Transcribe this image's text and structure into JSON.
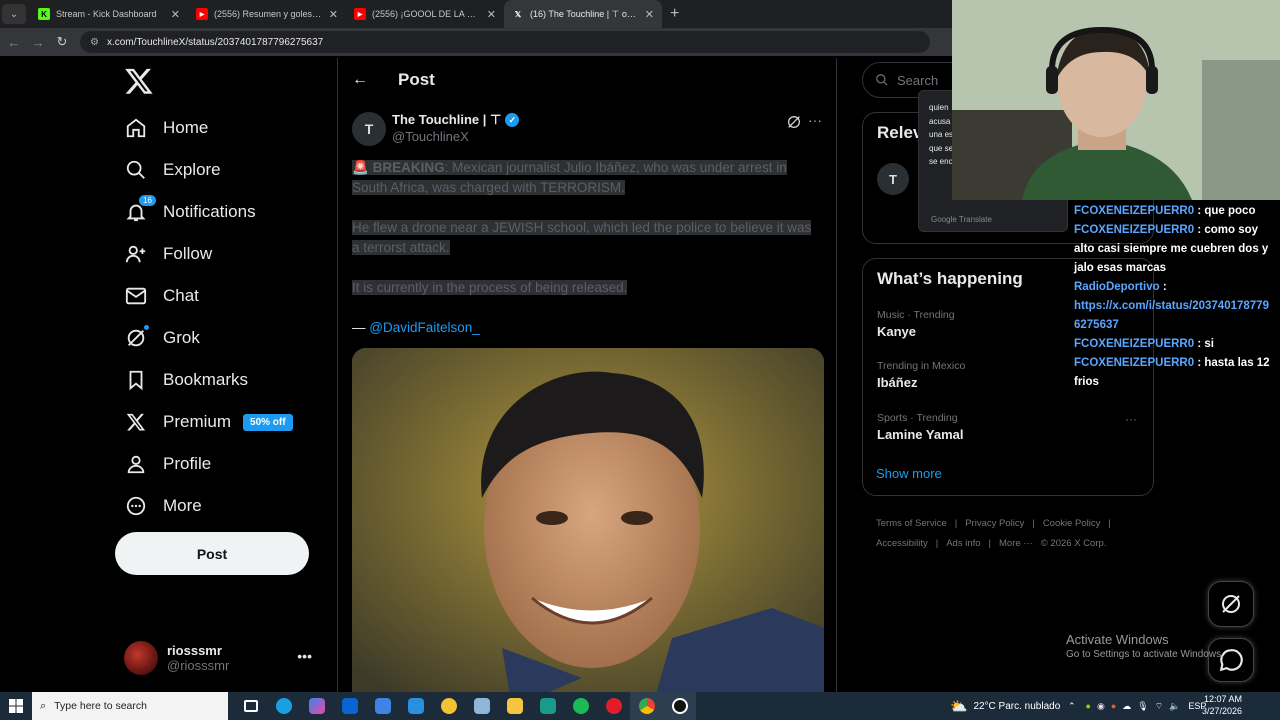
{
  "browser": {
    "tabs": [
      {
        "title": "Stream - Kick Dashboard",
        "favicon": "kick-icon",
        "color": "#53fc18"
      },
      {
        "title": "(2556) Resumen y goles - Boliv",
        "favicon": "youtube-icon",
        "color": "#ff0000"
      },
      {
        "title": "(2556) ¡GOOOL DE LA HORMIG",
        "favicon": "youtube-icon",
        "color": "#ff0000"
      },
      {
        "title": "(16) The Touchline | ⊤ on X: \"B",
        "favicon": "x-icon",
        "color": "#ffffff"
      }
    ],
    "url": "x.com/TouchlineX/status/2037401787796275637"
  },
  "nav": {
    "items": [
      {
        "label": "Home",
        "icon": "home-icon"
      },
      {
        "label": "Explore",
        "icon": "search-icon"
      },
      {
        "label": "Notifications",
        "icon": "bell-icon",
        "badge": "16"
      },
      {
        "label": "Follow",
        "icon": "follow-icon"
      },
      {
        "label": "Chat",
        "icon": "mail-icon"
      },
      {
        "label": "Grok",
        "icon": "grok-icon"
      },
      {
        "label": "Bookmarks",
        "icon": "bookmark-icon"
      },
      {
        "label": "Premium",
        "icon": "x-icon",
        "pill": "50% off"
      },
      {
        "label": "Profile",
        "icon": "person-icon"
      },
      {
        "label": "More",
        "icon": "more-circle-icon"
      }
    ],
    "post_label": "Post",
    "user": {
      "name": "riosssmr",
      "handle": "@riosssmr"
    }
  },
  "main": {
    "title": "Post",
    "tweet": {
      "author": "The Touchline | ⊤",
      "handle": "@TouchlineX",
      "avatar_letter": "T",
      "breaking": "BREAKING",
      "line1": ": Mexican journalist Julio Ibáñez, who was under arrest in South Africa, was charged with TERRORISM.",
      "line2": "He flew a drone near a JEWISH school, which led the police to believe it was a terrorst attack.",
      "line3": "It is currently in the process of being released.",
      "sig_dash": "— ",
      "sig_link": "@DavidFaitelson_"
    }
  },
  "right": {
    "search_placeholder": "Search",
    "relevant_title": "Relev",
    "happening_title": "What’s happening",
    "trends": [
      {
        "meta": "Music · Trending",
        "name": "Kanye"
      },
      {
        "meta": "Trending in Mexico",
        "name": "Ibáñez"
      },
      {
        "meta": "Sports · Trending",
        "name": "Lamine Yamal"
      }
    ],
    "show_more": "Show more",
    "footer": [
      "Terms of Service",
      "|",
      "Privacy Policy",
      "|",
      "Cookie Policy",
      "|",
      "Accessibility",
      "|",
      "Ads info",
      "|",
      "More ···",
      "© 2026 X Corp."
    ]
  },
  "translate_popup": {
    "lines": [
      "quien",
      "acusa",
      "una es",
      "que se",
      "se enc"
    ],
    "brand": "Google Translate"
  },
  "chat": [
    {
      "user": "FCOXENEIZEPUERR0",
      "text": " : que poco"
    },
    {
      "user": "FCOXENEIZEPUERR0",
      "text": " : como soy alto casi siempre me cuebren dos y jalo esas marcas"
    },
    {
      "user": "RadioDeportivo",
      "text": " : "
    },
    {
      "user": "",
      "text": "https://x.com/i/status/2037401787796275637"
    },
    {
      "user": "FCOXENEIZEPUERR0",
      "text": " : si"
    },
    {
      "user": "FCOXENEIZEPUERR0",
      "text": " : hasta las 12 frios"
    }
  ],
  "watermark": {
    "line1": "Activate Windows",
    "line2": "Go to Settings to activate Windows."
  },
  "taskbar": {
    "search_placeholder": "Type here to search",
    "weather": "22°C  Parc. nublado",
    "lang": "ESP",
    "time": "12:07 AM",
    "date": "3/27/2026"
  }
}
